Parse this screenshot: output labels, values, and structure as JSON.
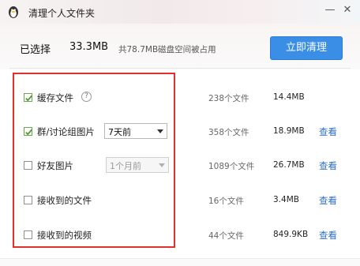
{
  "window": {
    "title": "清理个人文件夹",
    "minimize_glyph": "—",
    "close_glyph": "✕",
    "icon": "qq-penguin-icon"
  },
  "summary": {
    "selected_label": "已选择",
    "selected_size": "33.3MB",
    "disk_usage": "共78.7MB磁盘空间被占用",
    "clean_button": "立即清理"
  },
  "items": [
    {
      "label": "缓存文件",
      "checked": true,
      "help": "?",
      "count": "238个文件",
      "size": "14.4MB",
      "view": ""
    },
    {
      "label": "群/讨论组图片",
      "checked": true,
      "dropdown": "7天前",
      "dropdown_enabled": true,
      "count": "358个文件",
      "size": "18.9MB",
      "view": "查看"
    },
    {
      "label": "好友图片",
      "checked": false,
      "dropdown": "1个月前",
      "dropdown_enabled": false,
      "count": "1089个文件",
      "size": "26.7MB",
      "view": "查看"
    },
    {
      "label": "接收到的文件",
      "checked": false,
      "count": "16个文件",
      "size": "3.4MB",
      "view": "查看"
    },
    {
      "label": "接收到的视频",
      "checked": false,
      "count": "44个文件",
      "size": "849.9KB",
      "view": "查看"
    }
  ],
  "colors": {
    "accent_button": "#3a8ee6",
    "highlight_border": "#e32e2e",
    "link": "#2c6ec8",
    "checkbox_check": "#4e9a2f"
  }
}
